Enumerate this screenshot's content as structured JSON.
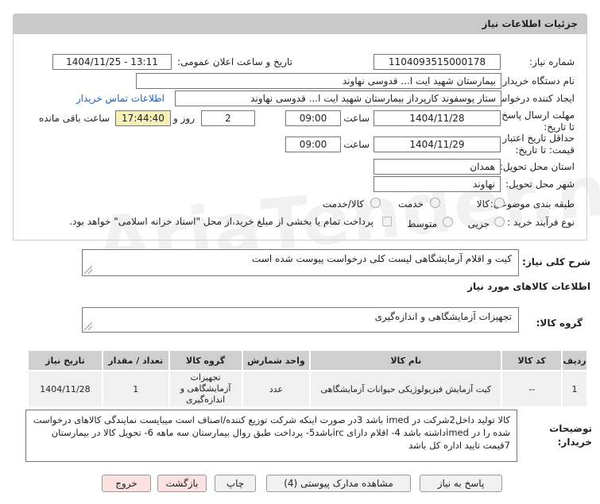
{
  "header": {
    "title": "جزئیات اطلاعات نیاز"
  },
  "fields": {
    "need_number_label": "شماره نیاز:",
    "need_number": "1104093515000178",
    "announce_label": "تاریخ و ساعت اعلان عمومی:",
    "announce_value": "1404/11/25 - 13:11",
    "buyer_org_label": "نام دستگاه خریدار:",
    "buyer_org": "بیمارستان شهید ایت ا... قدوسی نهاوند",
    "creator_label": "ایجاد کننده درخواست:",
    "creator": "ستار یوسفوند کارپرداز بیمارستان شهید ایت ا... قدوسی نهاوند",
    "contact_link": "اطلاعات تماس خریدار",
    "deadline_label": "مهلت ارسال پاسخ: تا تاریخ:",
    "deadline_date": "1404/11/28",
    "time_label": "ساعت",
    "deadline_time": "09:00",
    "days_value": "2",
    "days_label": "روز و",
    "remaining_time": "17:44:40",
    "remaining_label": "ساعت باقی مانده",
    "validity_label": "حداقل تاریخ اعتبار قیمت: تا تاریخ:",
    "validity_date": "1404/11/29",
    "validity_time": "09:00",
    "province_label": "استان محل تحویل:",
    "province": "همدان",
    "city_label": "شهر محل تحویل:",
    "city": "نهاوند",
    "category_label": "طبقه بندی موضوعی:",
    "category_options": [
      "کالا",
      "خدمت",
      "کالا/خدمت"
    ],
    "process_label": "نوع فرآیند خرید :",
    "process_options": [
      "جزیی",
      "متوسط"
    ],
    "payment_note": "پرداخت تمام یا بخشی از مبلغ خرید،از محل \"اسناد خزانه اسلامی\" خواهد بود."
  },
  "summary": {
    "label": "شرح کلی نیاز:",
    "value": "کیت و اقلام آزمایشگاهی لیست کلی درخواست پیوست شده است"
  },
  "goods": {
    "section_title": "اطلاعات کالاهای مورد نیاز",
    "group_label": "گروه کالا:",
    "group_value": "تجهیزات آزمایشگاهی و اندازه‌گیری"
  },
  "table": {
    "headers": [
      "ردیف",
      "کد کالا",
      "نام کالا",
      "واحد شمارش",
      "گروه کالا",
      "تعداد / مقدار",
      "تاریخ نیاز"
    ],
    "rows": [
      [
        "1",
        "--",
        "کیت آزمایش فیزیولوژیکی حیوانات آزمایشگاهی",
        "عدد",
        "تجهیزات آزمایشگاهی و اندازه‌گیری",
        "1",
        "1404/11/28"
      ]
    ]
  },
  "notes": {
    "label": "توضیحات خریدار:",
    "value": "کالا تولید داخل2شرکت در imed باشد 3در صورت اینکه شرکت توزیع کننده/اصناف است میبایست نمایندگی کالاهای درخواست شده را  در imedداشته باشد 4- اقلام دارای ircباشد5- پرداخت طبق روال بیمارستان سه ماهه 6- تحویل کالا در بیمارستان 7قیمت تایید اداره کل باشد"
  },
  "buttons": {
    "reply": "پاسخ به نیاز",
    "attachments": "مشاهده مدارک پیوستی (4)",
    "print": "چاپ",
    "back": "بازگشت",
    "exit": "خروج"
  },
  "watermark": "AriaTender.neT"
}
